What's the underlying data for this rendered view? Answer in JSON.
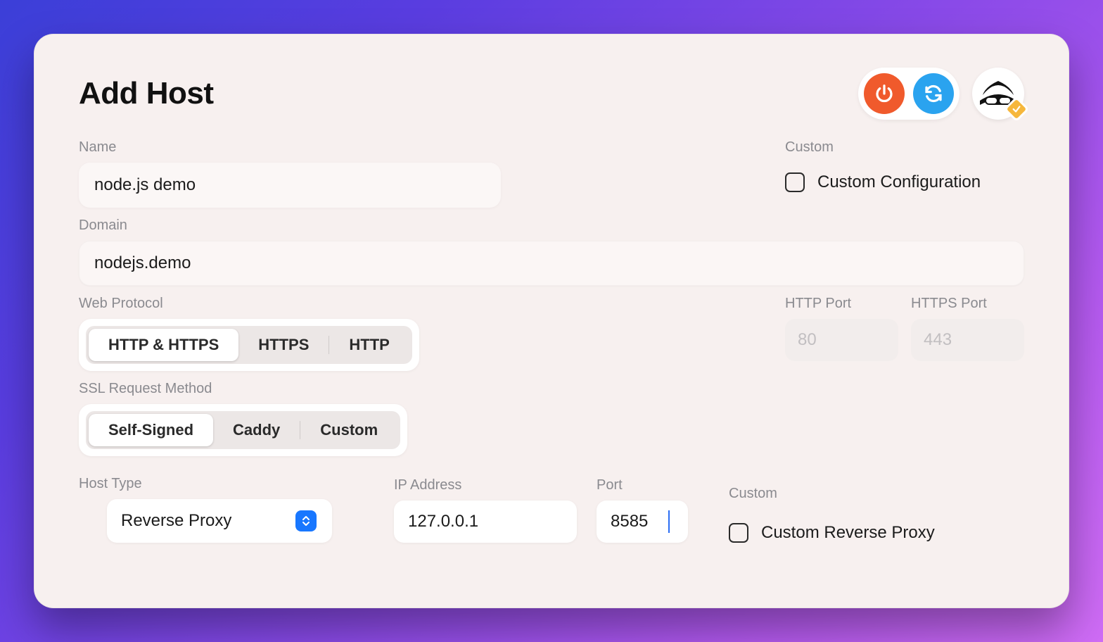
{
  "header": {
    "title": "Add Host",
    "power_icon": "power-icon",
    "refresh_icon": "refresh-icon",
    "avatar_badge": "verified"
  },
  "form": {
    "name_label": "Name",
    "name_value": "node.js demo",
    "domain_label": "Domain",
    "domain_value": "nodejs.demo",
    "web_protocol_label": "Web Protocol",
    "web_protocol_options": [
      "HTTP & HTTPS",
      "HTTPS",
      "HTTP"
    ],
    "web_protocol_selected": "HTTP & HTTPS",
    "http_port_label": "HTTP Port",
    "http_port_placeholder": "80",
    "https_port_label": "HTTPS Port",
    "https_port_placeholder": "443",
    "ssl_label": "SSL Request Method",
    "ssl_options": [
      "Self-Signed",
      "Caddy",
      "Custom"
    ],
    "ssl_selected": "Self-Signed",
    "custom_section_label": "Custom",
    "custom_config_label": "Custom Configuration",
    "custom_config_checked": false,
    "host_type_label": "Host Type",
    "host_type_value": "Reverse Proxy",
    "ip_label": "IP Address",
    "ip_value": "127.0.0.1",
    "port_label": "Port",
    "port_value": "8585",
    "custom_rp_section_label": "Custom",
    "custom_rp_label": "Custom Reverse Proxy",
    "custom_rp_checked": false
  }
}
